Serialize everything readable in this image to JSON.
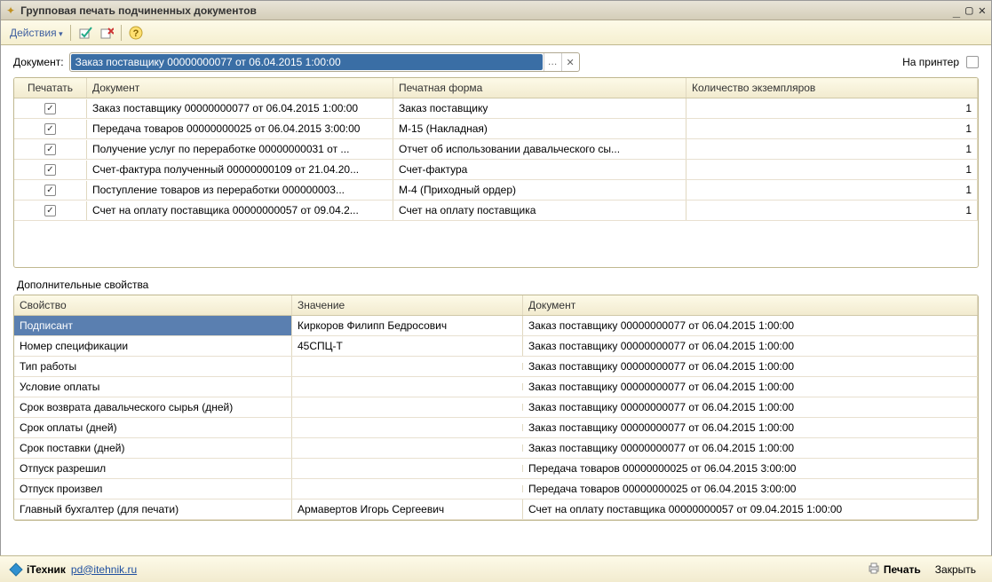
{
  "window": {
    "title": "Групповая печать подчиненных документов"
  },
  "toolbar": {
    "actions": "Действия"
  },
  "docfield": {
    "label": "Документ:",
    "value": "Заказ поставщику 00000000077 от 06.04.2015 1:00:00",
    "to_printer": "На принтер"
  },
  "grid1": {
    "headers": {
      "print": "Печатать",
      "doc": "Документ",
      "form": "Печатная форма",
      "qty": "Количество экземпляров"
    },
    "rows": [
      {
        "doc": "Заказ поставщику 00000000077 от 06.04.2015 1:00:00",
        "form": "Заказ поставщику",
        "qty": "1"
      },
      {
        "doc": "Передача товаров 00000000025 от 06.04.2015 3:00:00",
        "form": "М-15 (Накладная)",
        "qty": "1"
      },
      {
        "doc": "Получение услуг по переработке 00000000031 от ...",
        "form": "Отчет об использовании давальческого сы...",
        "qty": "1"
      },
      {
        "doc": "Счет-фактура полученный 00000000109 от 21.04.20...",
        "form": "Счет-фактура",
        "qty": "1"
      },
      {
        "doc": "Поступление товаров из переработки 000000003...",
        "form": "М-4 (Приходный ордер)",
        "qty": "1"
      },
      {
        "doc": "Счет на оплату поставщика 00000000057 от 09.04.2...",
        "form": "Счет на оплату поставщика",
        "qty": "1"
      }
    ]
  },
  "section2_label": "Дополнительные свойства",
  "grid2": {
    "headers": {
      "prop": "Свойство",
      "val": "Значение",
      "doc": "Документ"
    },
    "rows": [
      {
        "prop": "Подписант",
        "val": "Киркоров Филипп Бедросович",
        "doc": "Заказ поставщику 00000000077 от 06.04.2015 1:00:00"
      },
      {
        "prop": "Номер спецификации",
        "val": "45СПЦ-Т",
        "doc": "Заказ поставщику 00000000077 от 06.04.2015 1:00:00"
      },
      {
        "prop": "Тип работы",
        "val": "",
        "doc": "Заказ поставщику 00000000077 от 06.04.2015 1:00:00"
      },
      {
        "prop": "Условие оплаты",
        "val": "",
        "doc": "Заказ поставщику 00000000077 от 06.04.2015 1:00:00"
      },
      {
        "prop": "Срок возврата давальческого сырья (дней)",
        "val": "",
        "doc": "Заказ поставщику 00000000077 от 06.04.2015 1:00:00"
      },
      {
        "prop": "Срок оплаты (дней)",
        "val": "",
        "doc": "Заказ поставщику 00000000077 от 06.04.2015 1:00:00"
      },
      {
        "prop": "Срок поставки (дней)",
        "val": "",
        "doc": "Заказ поставщику 00000000077 от 06.04.2015 1:00:00"
      },
      {
        "prop": "Отпуск разрешил",
        "val": "",
        "doc": "Передача товаров 00000000025 от 06.04.2015 3:00:00"
      },
      {
        "prop": "Отпуск произвел",
        "val": "",
        "doc": "Передача товаров 00000000025 от 06.04.2015 3:00:00"
      },
      {
        "prop": "Главный бухгалтер (для печати)",
        "val": "Армавертов Игорь Сергеевич",
        "doc": "Счет на оплату поставщика 00000000057 от 09.04.2015 1:00:00"
      }
    ]
  },
  "footer": {
    "brand": "iТехник",
    "link": "pd@itehnik.ru",
    "print": "Печать",
    "close": "Закрыть"
  }
}
